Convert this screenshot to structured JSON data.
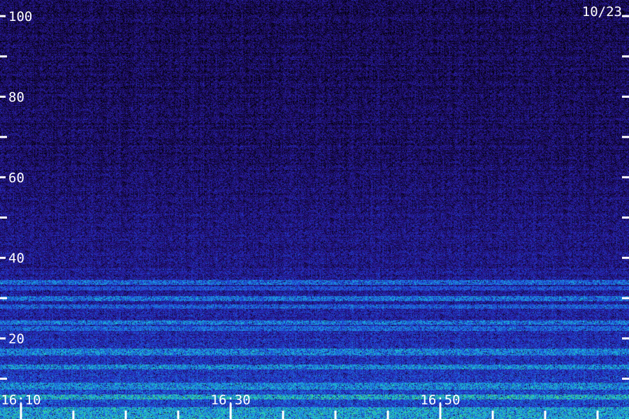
{
  "chart_data": {
    "type": "heatmap",
    "date_label": "10/23",
    "y_ticks": [
      {
        "value": 100,
        "label": "100"
      },
      {
        "value": 80,
        "label": "80"
      },
      {
        "value": 60,
        "label": "60"
      },
      {
        "value": 40,
        "label": "40"
      },
      {
        "value": 20,
        "label": "20"
      }
    ],
    "y_range": [
      0,
      104
    ],
    "x_ticks": [
      {
        "value": "16:10",
        "label": "16:10"
      },
      {
        "value": "16:30",
        "label": "16:30"
      },
      {
        "value": "16:50",
        "label": "16:50"
      }
    ],
    "x_range": [
      "16:08",
      "17:08"
    ],
    "x_minor_tick_step_minutes": 5,
    "y_minor_tick_step": 10,
    "colormap": [
      "#000000",
      "#1a0a55",
      "#2a1a9a",
      "#1f3ad0",
      "#1e78e0",
      "#19c4d8",
      "#40e07a",
      "#c8ff40"
    ],
    "intensity_bands": [
      {
        "freq": [
          0,
          3
        ],
        "level": 0.78
      },
      {
        "freq": [
          5,
          6
        ],
        "level": 0.82
      },
      {
        "freq": [
          7.5,
          9
        ],
        "level": 0.72
      },
      {
        "freq": [
          12.5,
          13.5
        ],
        "level": 0.72
      },
      {
        "freq": [
          16,
          17.5
        ],
        "level": 0.7
      },
      {
        "freq": [
          22,
          23
        ],
        "level": 0.62
      },
      {
        "freq": [
          23.5,
          24.5
        ],
        "level": 0.68
      },
      {
        "freq": [
          27.5,
          28.5
        ],
        "level": 0.6
      },
      {
        "freq": [
          29.5,
          30.5
        ],
        "level": 0.66
      },
      {
        "freq": [
          32,
          33
        ],
        "level": 0.55
      },
      {
        "freq": [
          33.5,
          34.5
        ],
        "level": 0.64
      }
    ]
  }
}
